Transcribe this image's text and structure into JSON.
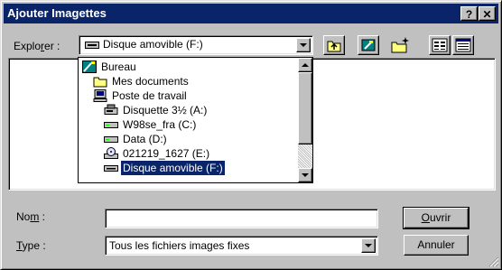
{
  "window": {
    "title": "Ajouter Imagettes",
    "help_btn": "?",
    "close_btn": "✕"
  },
  "explorer": {
    "label_pre": "Explo",
    "label_ul": "r",
    "label_post": "er :",
    "value": "Disque amovible (F:)"
  },
  "toolbar": {
    "up": "up-folder-icon",
    "desktop": "desktop-icon",
    "new_folder": "new-folder-icon",
    "list_view": "list-view-icon",
    "details_view": "details-view-icon"
  },
  "dropdown": {
    "items": [
      {
        "label": "Bureau",
        "icon": "desktop-icon",
        "indent": 0,
        "selected": false
      },
      {
        "label": "Mes documents",
        "icon": "folder-icon",
        "indent": 1,
        "selected": false
      },
      {
        "label": "Poste de travail",
        "icon": "computer-icon",
        "indent": 1,
        "selected": false
      },
      {
        "label": "Disquette 3½ (A:)",
        "icon": "floppy-icon",
        "indent": 2,
        "selected": false
      },
      {
        "label": "W98se_fra (C:)",
        "icon": "drive-icon",
        "indent": 2,
        "selected": false
      },
      {
        "label": "Data (D:)",
        "icon": "drive-icon",
        "indent": 2,
        "selected": false
      },
      {
        "label": "021219_1627 (E:)",
        "icon": "cdrom-icon",
        "indent": 2,
        "selected": false
      },
      {
        "label": "Disque amovible (F:)",
        "icon": "removable-drive-icon",
        "indent": 2,
        "selected": true
      }
    ]
  },
  "filename": {
    "label_pre": "No",
    "label_ul": "m",
    "label_post": " :",
    "value": ""
  },
  "filetype": {
    "label_pre": "",
    "label_ul": "T",
    "label_post": "ype :",
    "value": "Tous les fichiers images fixes"
  },
  "buttons": {
    "open_ul": "O",
    "open_rest": "uvrir",
    "cancel": "Annuler"
  }
}
